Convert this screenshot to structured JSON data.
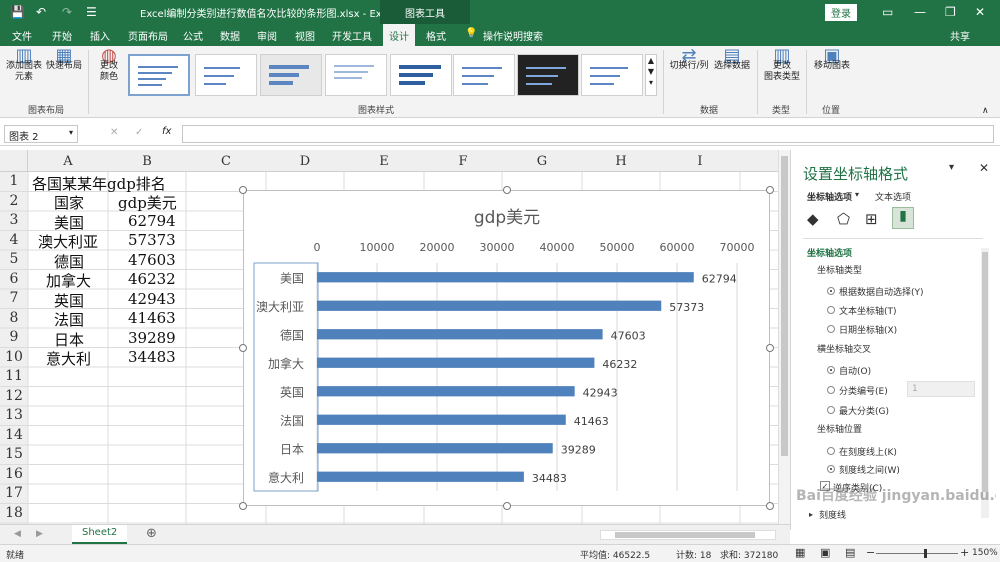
{
  "titlebar": {
    "file_title": "Excel编制分类别进行数值名次比较的条形图.xlsx - Excel",
    "context_tab": "图表工具",
    "login": "登录"
  },
  "tabs": [
    "文件",
    "开始",
    "插入",
    "页面布局",
    "公式",
    "数据",
    "审阅",
    "视图",
    "开发工具",
    "设计",
    "格式"
  ],
  "tell_me": "操作说明搜索",
  "share": "共享",
  "ribbon": {
    "add_element": "添加图表\n元素",
    "quick_layout": "快速布局",
    "group_layout": "图表布局",
    "change_colors": "更改\n颜色",
    "group_styles": "图表样式",
    "switch_row_col": "切换行/列",
    "select_data": "选择数据",
    "group_data": "数据",
    "change_type": "更改\n图表类型",
    "group_type": "类型",
    "move_chart": "移动图表",
    "group_location": "位置"
  },
  "formula_bar": {
    "name_box": "图表 2",
    "fx": "fx"
  },
  "columns": [
    "A",
    "B",
    "C",
    "D",
    "E",
    "F",
    "G",
    "H",
    "I"
  ],
  "rows": [
    "1",
    "2",
    "3",
    "4",
    "5",
    "6",
    "7",
    "8",
    "9",
    "10",
    "11",
    "12",
    "13",
    "14",
    "15",
    "16",
    "17",
    "18"
  ],
  "table": {
    "title": "各国某某年gdp排名",
    "header": [
      "国家",
      "gdp美元"
    ],
    "rows": [
      [
        "美国",
        "62794"
      ],
      [
        "澳大利亚",
        "57373"
      ],
      [
        "德国",
        "47603"
      ],
      [
        "加拿大",
        "46232"
      ],
      [
        "英国",
        "42943"
      ],
      [
        "法国",
        "41463"
      ],
      [
        "日本",
        "39289"
      ],
      [
        "意大利",
        "34483"
      ]
    ]
  },
  "chart_data": {
    "type": "bar",
    "title": "gdp美元",
    "categories": [
      "美国",
      "澳大利亚",
      "德国",
      "加拿大",
      "英国",
      "法国",
      "日本",
      "意大利"
    ],
    "values": [
      62794,
      57373,
      47603,
      46232,
      42943,
      41463,
      39289,
      34483
    ],
    "xlim": [
      0,
      70000
    ],
    "xticks": [
      "0",
      "10000",
      "20000",
      "30000",
      "40000",
      "50000",
      "60000",
      "70000"
    ],
    "axis_position": "top",
    "grid": true,
    "data_labels": true,
    "bar_color": "#4f81bd"
  },
  "pane": {
    "title": "设置坐标轴格式",
    "tab_axis": "坐标轴选项",
    "tab_text": "文本选项",
    "section": "坐标轴选项",
    "axis_type": "坐标轴类型",
    "axis_type_opts": [
      "根据数据自动选择(Y)",
      "文本坐标轴(T)",
      "日期坐标轴(X)"
    ],
    "cross": "横坐标轴交叉",
    "cross_opts": [
      "自动(O)",
      "分类编号(E)",
      "最大分类(G)"
    ],
    "cross_value": "1",
    "position": "坐标轴位置",
    "position_opts": [
      "在刻度线上(K)",
      "刻度线之间(W)"
    ],
    "reverse": "逆序类别(C)",
    "ticks": "刻度线"
  },
  "sheet_tab": "Sheet2",
  "status": {
    "ready": "就绪",
    "avg": "平均值: 46522.5",
    "count": "计数: 18",
    "sum": "求和: 372180",
    "zoom": "150%"
  },
  "watermark": "Bai百度经验 jingyan.baidu.com"
}
